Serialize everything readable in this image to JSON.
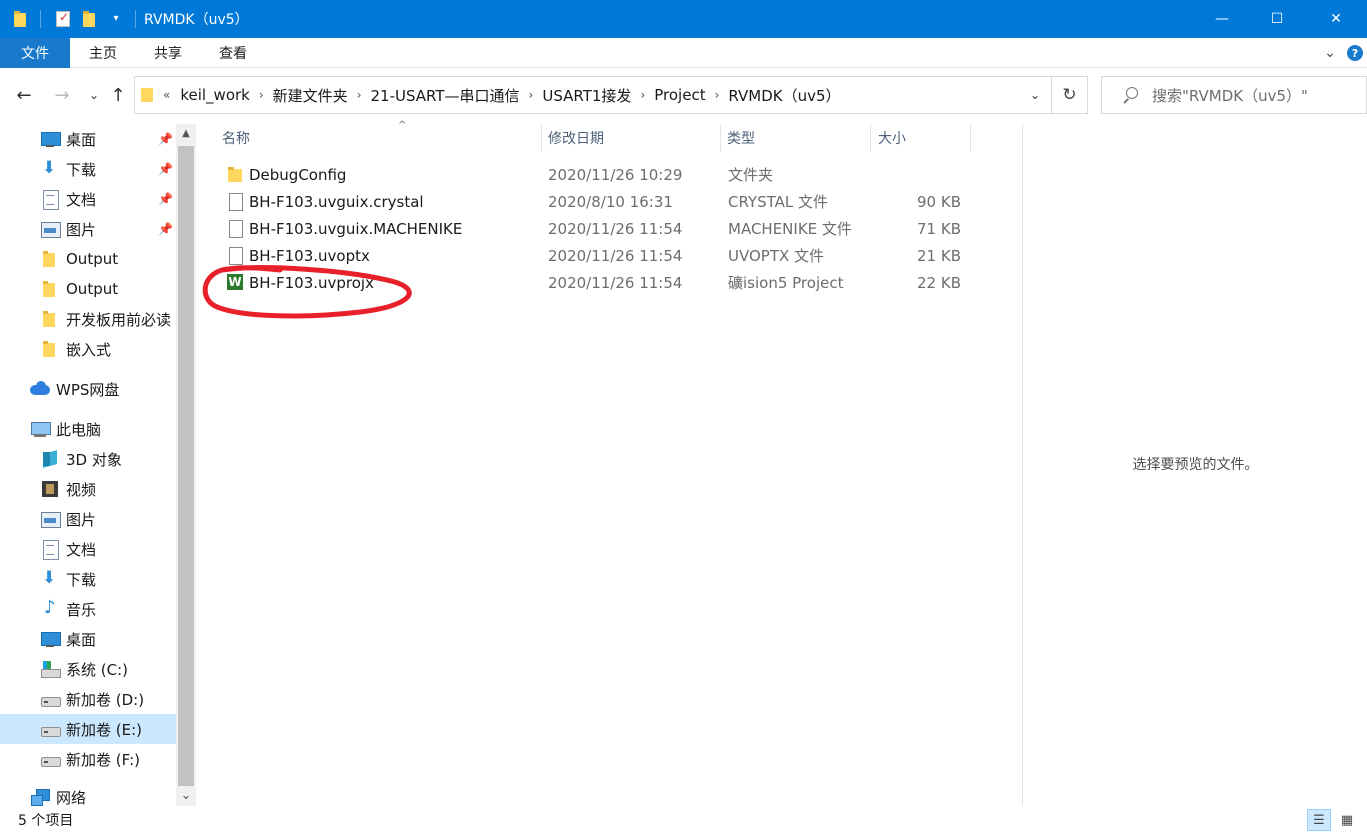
{
  "window": {
    "title": "RVMDK（uv5）",
    "minimize": "—",
    "maximize": "☐",
    "close": "✕"
  },
  "ribbon": {
    "tabs": [
      "文件",
      "主页",
      "共享",
      "查看"
    ],
    "expand": "⌄",
    "help": "?"
  },
  "nav": {
    "back": "←",
    "forward": "→",
    "recent": "⌄",
    "up": "↑"
  },
  "address": {
    "overflow": "«",
    "crumbs": [
      "keil_work",
      "新建文件夹",
      "21-USART—串口通信",
      "USART1接发",
      "Project",
      "RVMDK（uv5）"
    ],
    "separator": "›",
    "dropdown": "⌄",
    "refresh": "↻"
  },
  "search": {
    "placeholder": "搜索\"RVMDK（uv5）\""
  },
  "sidebar": {
    "items": [
      {
        "label": "桌面",
        "icon": "desktop-icon",
        "pinned": true
      },
      {
        "label": "下载",
        "icon": "download-icon",
        "pinned": true
      },
      {
        "label": "文档",
        "icon": "document-icon",
        "pinned": true
      },
      {
        "label": "图片",
        "icon": "picture-icon",
        "pinned": true
      },
      {
        "label": "Output",
        "icon": "folder-icon"
      },
      {
        "label": "Output",
        "icon": "folder-icon"
      },
      {
        "label": "开发板用前必读",
        "icon": "folder-icon"
      },
      {
        "label": "嵌入式",
        "icon": "folder-icon"
      },
      {
        "label": "WPS网盘",
        "icon": "cloud-icon"
      },
      {
        "label": "此电脑",
        "icon": "computer-icon"
      },
      {
        "label": "3D 对象",
        "icon": "3d-objects-icon"
      },
      {
        "label": "视频",
        "icon": "video-icon"
      },
      {
        "label": "图片",
        "icon": "picture-icon"
      },
      {
        "label": "文档",
        "icon": "document-icon"
      },
      {
        "label": "下载",
        "icon": "download-icon"
      },
      {
        "label": "音乐",
        "icon": "music-icon"
      },
      {
        "label": "桌面",
        "icon": "desktop-icon"
      },
      {
        "label": "系统 (C:)",
        "icon": "system-drive-icon"
      },
      {
        "label": "新加卷 (D:)",
        "icon": "drive-icon"
      },
      {
        "label": "新加卷 (E:)",
        "icon": "drive-icon",
        "selected": true
      },
      {
        "label": "新加卷 (F:)",
        "icon": "drive-icon"
      },
      {
        "label": "网络",
        "icon": "network-icon"
      }
    ],
    "pin_glyph": "📌",
    "scroll_up": "▲",
    "scroll_down": "⌄"
  },
  "filelist": {
    "columns": {
      "name": "名称",
      "modified": "修改日期",
      "type": "类型",
      "size": "大小"
    },
    "sort_indicator": "^",
    "rows": [
      {
        "name": "DebugConfig",
        "modified": "2020/11/26 10:29",
        "type": "文件夹",
        "size": "",
        "icon": "folder-icon"
      },
      {
        "name": "BH-F103.uvguix.crystal",
        "modified": "2020/8/10 16:31",
        "type": "CRYSTAL 文件",
        "size": "90 KB",
        "icon": "file-icon"
      },
      {
        "name": "BH-F103.uvguix.MACHENIKE",
        "modified": "2020/11/26 11:54",
        "type": "MACHENIKE 文件",
        "size": "71 KB",
        "icon": "file-icon"
      },
      {
        "name": "BH-F103.uvoptx",
        "modified": "2020/11/26 11:54",
        "type": "UVOPTX 文件",
        "size": "21 KB",
        "icon": "file-icon"
      },
      {
        "name": "BH-F103.uvprojx",
        "modified": "2020/11/26 11:54",
        "type": "礦ision5 Project",
        "size": "22 KB",
        "icon": "uvision-project-icon"
      }
    ],
    "annotation_color": "#e8202a"
  },
  "preview": {
    "message": "选择要预览的文件。"
  },
  "status": {
    "count": "5 个项目",
    "details_view": "☰",
    "large_icons_view": "▦"
  }
}
